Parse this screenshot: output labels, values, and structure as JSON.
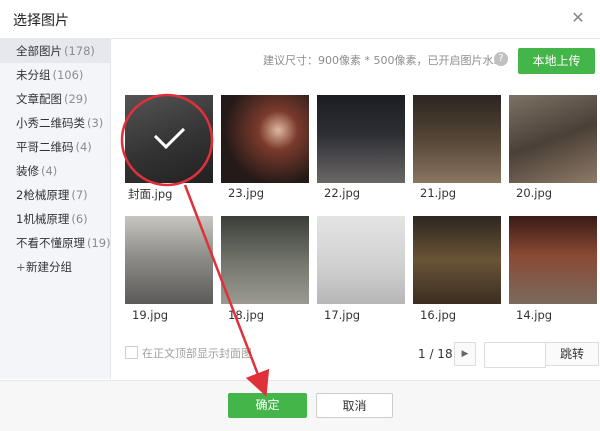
{
  "dialog": {
    "title": "选择图片",
    "close_icon": "close-icon"
  },
  "sidebar": {
    "items": [
      {
        "label": "全部图片",
        "count": "(178)"
      },
      {
        "label": "未分组",
        "count": "(106)"
      },
      {
        "label": "文章配图",
        "count": "(29)"
      },
      {
        "label": "小秀二维码类",
        "count": "(3)"
      },
      {
        "label": "平哥二维码",
        "count": "(4)"
      },
      {
        "label": "装修",
        "count": "(4)"
      },
      {
        "label": "2枪械原理",
        "count": "(7)"
      },
      {
        "label": "1机械原理",
        "count": "(6)"
      },
      {
        "label": "不看不懂原理",
        "count": "(19)"
      }
    ],
    "add_label": "新建分组"
  },
  "toolbar": {
    "hint": "建议尺寸：900像素 * 500像素，已开启图片水印",
    "help_icon": "?",
    "upload_label": "本地上传"
  },
  "images": [
    {
      "name": "封面.jpg",
      "color": "#6f6f6f",
      "selected": true
    },
    {
      "name": "23.jpg",
      "color": "#3b2a24",
      "selected": false
    },
    {
      "name": "22.jpg",
      "color": "#2a2a2e",
      "selected": false
    },
    {
      "name": "21.jpg",
      "color": "#4a4036",
      "selected": false
    },
    {
      "name": "20.jpg",
      "color": "#5c5247",
      "selected": false
    },
    {
      "name": "19.jpg",
      "color": "#8a8c8a",
      "selected": false
    },
    {
      "name": "18.jpg",
      "color": "#5b5f58",
      "selected": false
    },
    {
      "name": "17.jpg",
      "color": "#c9c9c9",
      "selected": false
    },
    {
      "name": "16.jpg",
      "color": "#4d3f30",
      "selected": false
    },
    {
      "name": "14.jpg",
      "color": "#6a3a2e",
      "selected": false
    }
  ],
  "options": {
    "checkbox_label": "在正文顶部显示封面图"
  },
  "pager": {
    "text": "1 / 18",
    "next_icon": "▶",
    "jump_label": "跳转"
  },
  "footer": {
    "ok_label": "确定",
    "cancel_label": "取消"
  },
  "colors": {
    "accent": "#44b549",
    "annotation": "#e0303a"
  }
}
